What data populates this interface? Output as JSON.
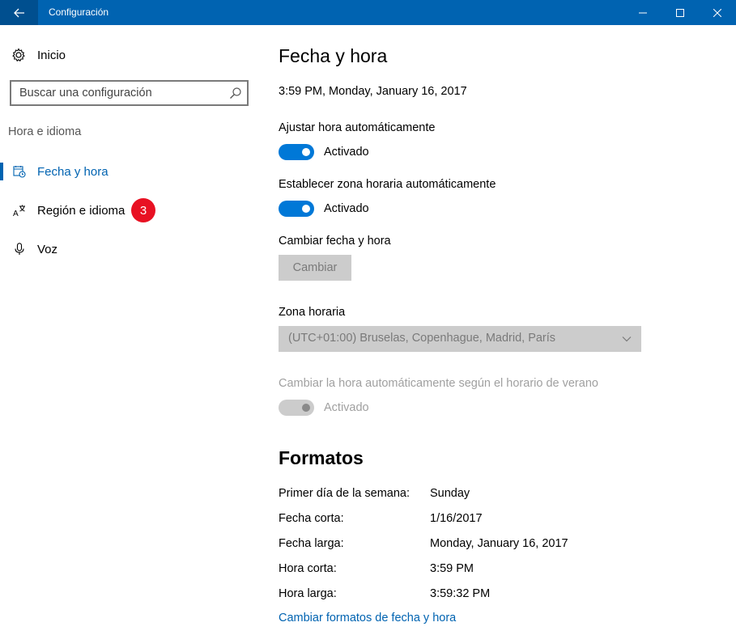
{
  "window": {
    "title": "Configuración"
  },
  "sidebar": {
    "home_label": "Inicio",
    "search_placeholder": "Buscar una configuración",
    "section_label": "Hora e idioma",
    "items": [
      {
        "label": "Fecha y hora",
        "icon": "calendar-clock-icon",
        "selected": true
      },
      {
        "label": "Región e idioma",
        "icon": "language-icon",
        "badge": "3"
      },
      {
        "label": "Voz",
        "icon": "microphone-icon"
      }
    ]
  },
  "main": {
    "title": "Fecha y hora",
    "current_datetime": "3:59 PM, Monday, January 16, 2017",
    "auto_time": {
      "label": "Ajustar hora automáticamente",
      "state": "Activado"
    },
    "auto_timezone": {
      "label": "Establecer zona horaria automáticamente",
      "state": "Activado"
    },
    "change_datetime": {
      "label": "Cambiar fecha y hora",
      "button": "Cambiar"
    },
    "timezone": {
      "label": "Zona horaria",
      "value": "(UTC+01:00) Bruselas, Copenhague, Madrid, París"
    },
    "dst": {
      "label": "Cambiar la hora automáticamente según el horario de verano",
      "state": "Activado"
    },
    "formats": {
      "title": "Formatos",
      "rows": [
        {
          "key": "Primer día de la semana:",
          "value": "Sunday"
        },
        {
          "key": "Fecha corta:",
          "value": "1/16/2017"
        },
        {
          "key": "Fecha larga:",
          "value": "Monday, January 16, 2017"
        },
        {
          "key": "Hora corta:",
          "value": "3:59 PM"
        },
        {
          "key": "Hora larga:",
          "value": "3:59:32 PM"
        }
      ],
      "link": "Cambiar formatos de fecha y hora"
    }
  },
  "colors": {
    "accent": "#0078d7",
    "titlebar": "#0063b1",
    "badge": "#e81123"
  }
}
